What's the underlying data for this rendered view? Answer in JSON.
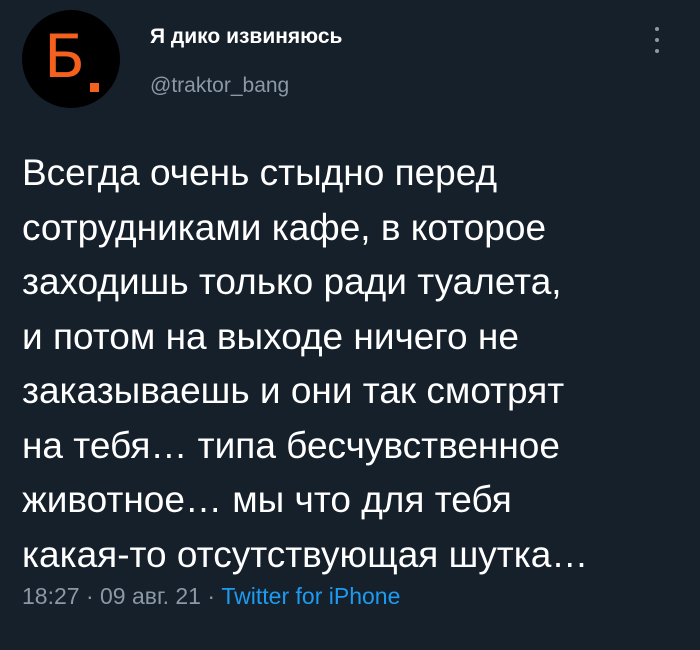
{
  "profile": {
    "avatar_letter": "Б",
    "avatar_letter_color": "#f4601e",
    "display_name": "Я дико извиняюсь",
    "handle": "@traktor_bang"
  },
  "menu": {
    "icon": "more-vertical-icon"
  },
  "tweet": {
    "lines": [
      "Всегда очень стыдно перед",
      "сотрудниками кафе, в которое",
      "заходишь только ради туалета,",
      "и потом на выходе ничего не",
      "заказываешь и они так смотрят",
      "на тебя… типа бесчувственное",
      "животное… мы что для тебя",
      "какая-то отсутствующая шутка…"
    ]
  },
  "meta": {
    "time": "18:27",
    "separator": " · ",
    "date": "09 авг. 21",
    "source": "Twitter for iPhone"
  },
  "colors": {
    "background": "#15202b",
    "secondary_text": "#8b98a5",
    "link": "#1d9bf0"
  }
}
